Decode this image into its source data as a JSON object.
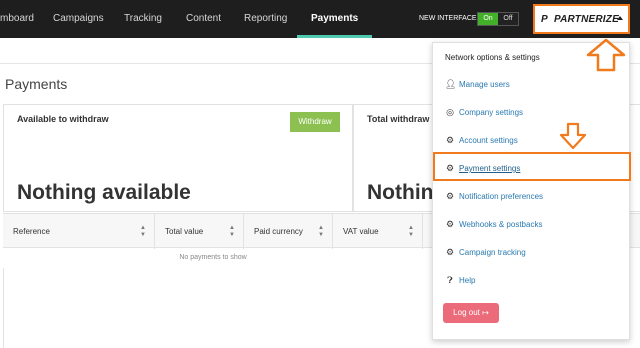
{
  "nav": {
    "items": [
      "mboard",
      "Campaigns",
      "Tracking",
      "Content",
      "Reporting",
      "Payments"
    ],
    "active": "Payments",
    "new_interface_label": "NEW INTERFACE",
    "toggle_on": "On",
    "toggle_off": "Off",
    "brand_name": "PARTNERIZE",
    "brand_mark": "P"
  },
  "page": {
    "title": "Payments"
  },
  "panels": [
    {
      "title": "Available to withdraw",
      "value": "Nothing available",
      "button": "Withdraw"
    },
    {
      "title": "Total withdraw",
      "value": "Nothin"
    }
  ],
  "table": {
    "columns": [
      "Reference",
      "Total value",
      "Paid currency",
      "VAT value"
    ],
    "empty_message": "No payments to show"
  },
  "dropdown": {
    "header": "Network options & settings",
    "items": [
      {
        "label": "Manage users",
        "icon": "user-icon"
      },
      {
        "label": "Company settings",
        "icon": "globe-icon"
      },
      {
        "label": "Account settings",
        "icon": "gear-icon"
      },
      {
        "label": "Payment settings",
        "icon": "gear-icon"
      },
      {
        "label": "Notification preferences",
        "icon": "gear-icon"
      },
      {
        "label": "Webhooks & postbacks",
        "icon": "gear-icon"
      },
      {
        "label": "Campaign tracking",
        "icon": "gear-icon"
      },
      {
        "label": "Help",
        "icon": "question-icon"
      }
    ],
    "logout": "Log out"
  },
  "colors": {
    "nav_bg": "#1e1e1e",
    "active_underline": "#4fc9b0",
    "toggle_on": "#43b02a",
    "withdraw_button": "#8cc152",
    "link": "#2a7ab0",
    "highlight_orange": "#f07a1c",
    "logout_button": "#ec6b7a"
  }
}
